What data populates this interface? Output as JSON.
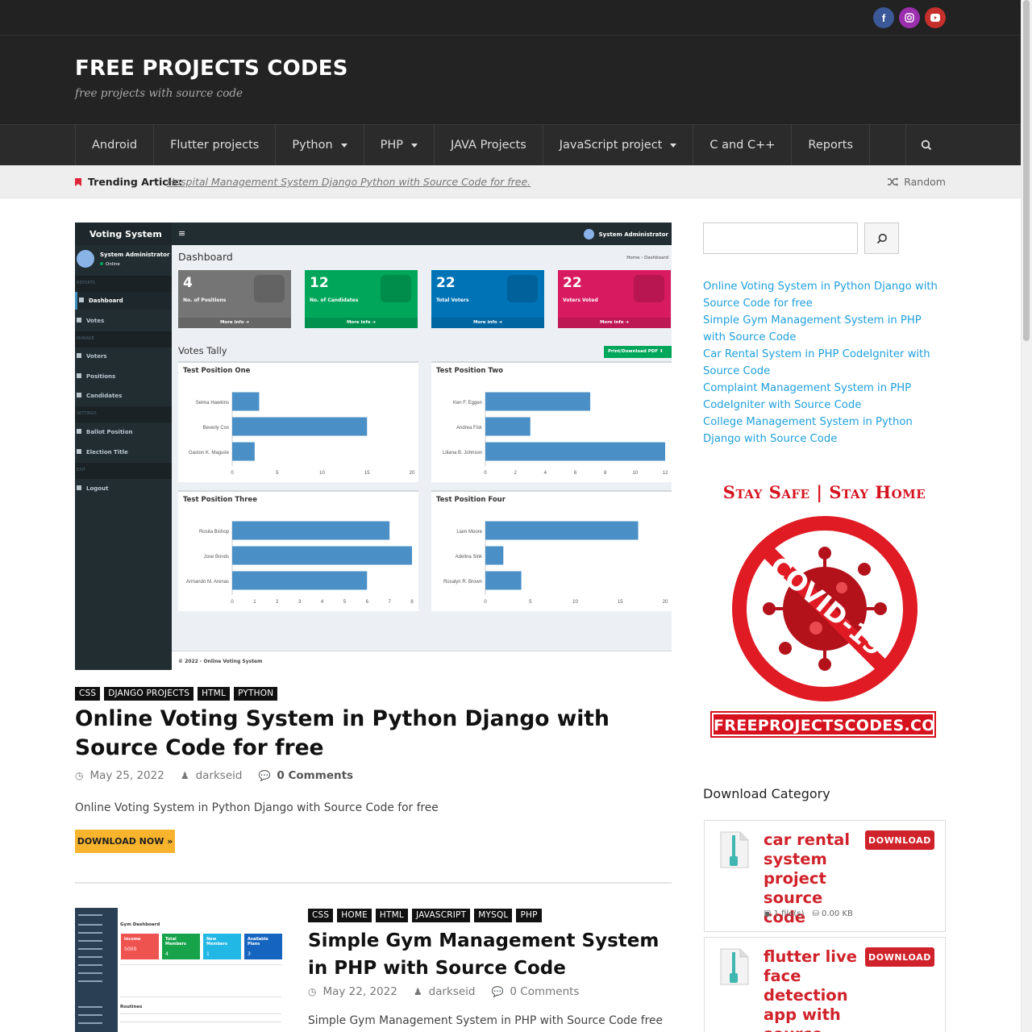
{
  "socials": [
    "facebook",
    "instagram",
    "youtube"
  ],
  "site": {
    "title": "FREE PROJECTS CODES",
    "description": "free projects with source code"
  },
  "nav": {
    "items": [
      {
        "label": "Android",
        "dropdown": false
      },
      {
        "label": "Flutter projects",
        "dropdown": false
      },
      {
        "label": "Python",
        "dropdown": true
      },
      {
        "label": "PHP",
        "dropdown": true
      },
      {
        "label": "JAVA Projects",
        "dropdown": false
      },
      {
        "label": "JavaScript project",
        "dropdown": true
      },
      {
        "label": "C and C++",
        "dropdown": false
      },
      {
        "label": "Reports",
        "dropdown": false
      }
    ]
  },
  "trending": {
    "label": "Trending Article:",
    "link": "Hospital Management System Django Python with Source Code for free.",
    "random": "Random"
  },
  "featured_image": {
    "brand": "Voting System",
    "menu": "≡",
    "admin": "System Administrator",
    "user_name": "System Administrator",
    "user_status": "Online",
    "sections": [
      "REPORTS",
      "MANAGE",
      "SETTINGS",
      "EXIT"
    ],
    "links": [
      "Dashboard",
      "Votes",
      "Voters",
      "Positions",
      "Candidates",
      "Ballot Position",
      "Election Title",
      "Logout"
    ],
    "title": "Dashboard",
    "crumb": "Home  ›  Dashboard",
    "boxes": [
      {
        "num": "4",
        "label": "No. of Positions",
        "more": "More info ➜"
      },
      {
        "num": "12",
        "label": "No. of Candidates",
        "more": "More info ➜"
      },
      {
        "num": "22",
        "label": "Total Voters",
        "more": "More info ➜"
      },
      {
        "num": "22",
        "label": "Voters Voted",
        "more": "More info ➜"
      }
    ],
    "tally": "Votes Tally",
    "print": "Print/Download PDF ⬇",
    "panels": [
      {
        "title": "Test Position One",
        "names": [
          "Selma Hawkins",
          "Beverly Cox",
          "Gaston K. Maguire"
        ],
        "values": [
          3,
          15,
          2.5
        ],
        "ticks": [
          "0",
          "5",
          "10",
          "15",
          "20"
        ],
        "max": 20
      },
      {
        "title": "Test Position Two",
        "names": [
          "Ken F. Eggen",
          "Andrea Fisk",
          "Liliana B. Johnson"
        ],
        "values": [
          7,
          3,
          12
        ],
        "ticks": [
          "0",
          "2",
          "4",
          "6",
          "8",
          "10",
          "12"
        ],
        "max": 12
      },
      {
        "title": "Test Position Three",
        "names": [
          "Rosita Bishop",
          "Jose Bonds",
          "Armando M. Arenas"
        ],
        "values": [
          7,
          8,
          6
        ],
        "ticks": [
          "0",
          "1",
          "2",
          "3",
          "4",
          "5",
          "6",
          "7",
          "8"
        ],
        "max": 8
      },
      {
        "title": "Test Position Four",
        "names": [
          "Liam Moore",
          "Adelina Sink",
          "Rosalyn R. Brown"
        ],
        "values": [
          17,
          2,
          4
        ],
        "ticks": [
          "0",
          "5",
          "10",
          "15",
          "20"
        ],
        "max": 20
      }
    ],
    "footer": "© 2022 - Online Voting System"
  },
  "post1": {
    "tags": [
      "CSS",
      "DJANGO PROJECTS",
      "HTML",
      "PYTHON"
    ],
    "title": "Online Voting System in Python Django with Source Code for free",
    "date": "May 25, 2022",
    "author": "darkseid",
    "comments": "0 Comments",
    "excerpt": "Online Voting System in Python Django with Source Code for free",
    "button": "DOWNLOAD NOW »"
  },
  "post2": {
    "tags": [
      "CSS",
      "HOME",
      "HTML",
      "JAVASCRIPT",
      "MYSQL",
      "PHP"
    ],
    "title": "Simple Gym Management System in PHP with Source Code",
    "date": "May 22, 2022",
    "author": "darkseid",
    "comments": "0 Comments",
    "excerpt": "Simple Gym Management System in PHP with Source Code free",
    "thumb": {
      "title": "Gym Dashboard",
      "boxes": [
        {
          "label": "Income",
          "value": "5000"
        },
        {
          "label": "Total Members",
          "value": "4"
        },
        {
          "label": "New Members",
          "value": "1"
        },
        {
          "label": "Available Plans",
          "value": "3"
        }
      ],
      "routines": "Routines"
    }
  },
  "sidebar": {
    "recent": [
      "Online Voting System in Python Django with Source Code for free",
      "Simple Gym Management System in PHP with Source Code",
      "Car Rental System in PHP CodeIgniter with Source Code",
      "Complaint Management System in PHP CodeIgniter with Source Code",
      "College Management System in Python Django with Source Code"
    ],
    "banner": {
      "top": "Stay Safe | Stay Home",
      "ring": "COVID-19",
      "bottom": "FREEPROJECTSCODES.COM"
    },
    "download_heading": "Download Category",
    "downloads": [
      {
        "name": "car rental system project source code",
        "button": "DOWNLOAD",
        "files": "1 file(s)",
        "size": "0.00 KB"
      },
      {
        "name": "flutter live face detection app with source code",
        "button": "DOWNLOAD"
      }
    ]
  },
  "colors": {
    "accent": "#f8b42d",
    "link": "#1e9fdb",
    "red": "#d0222a"
  }
}
